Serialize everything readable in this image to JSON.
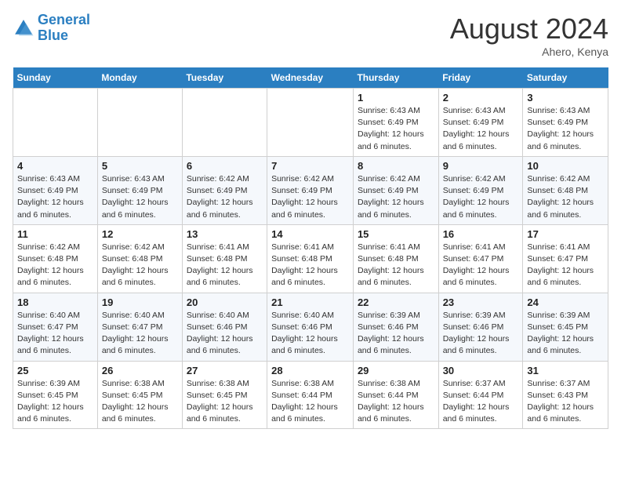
{
  "header": {
    "logo_line1": "General",
    "logo_line2": "Blue",
    "month": "August 2024",
    "location": "Ahero, Kenya"
  },
  "columns": [
    "Sunday",
    "Monday",
    "Tuesday",
    "Wednesday",
    "Thursday",
    "Friday",
    "Saturday"
  ],
  "weeks": [
    [
      {
        "day": "",
        "info": ""
      },
      {
        "day": "",
        "info": ""
      },
      {
        "day": "",
        "info": ""
      },
      {
        "day": "",
        "info": ""
      },
      {
        "day": "1",
        "info": "Sunrise: 6:43 AM\nSunset: 6:49 PM\nDaylight: 12 hours and 6 minutes."
      },
      {
        "day": "2",
        "info": "Sunrise: 6:43 AM\nSunset: 6:49 PM\nDaylight: 12 hours and 6 minutes."
      },
      {
        "day": "3",
        "info": "Sunrise: 6:43 AM\nSunset: 6:49 PM\nDaylight: 12 hours and 6 minutes."
      }
    ],
    [
      {
        "day": "4",
        "info": "Sunrise: 6:43 AM\nSunset: 6:49 PM\nDaylight: 12 hours and 6 minutes."
      },
      {
        "day": "5",
        "info": "Sunrise: 6:43 AM\nSunset: 6:49 PM\nDaylight: 12 hours and 6 minutes."
      },
      {
        "day": "6",
        "info": "Sunrise: 6:42 AM\nSunset: 6:49 PM\nDaylight: 12 hours and 6 minutes."
      },
      {
        "day": "7",
        "info": "Sunrise: 6:42 AM\nSunset: 6:49 PM\nDaylight: 12 hours and 6 minutes."
      },
      {
        "day": "8",
        "info": "Sunrise: 6:42 AM\nSunset: 6:49 PM\nDaylight: 12 hours and 6 minutes."
      },
      {
        "day": "9",
        "info": "Sunrise: 6:42 AM\nSunset: 6:49 PM\nDaylight: 12 hours and 6 minutes."
      },
      {
        "day": "10",
        "info": "Sunrise: 6:42 AM\nSunset: 6:48 PM\nDaylight: 12 hours and 6 minutes."
      }
    ],
    [
      {
        "day": "11",
        "info": "Sunrise: 6:42 AM\nSunset: 6:48 PM\nDaylight: 12 hours and 6 minutes."
      },
      {
        "day": "12",
        "info": "Sunrise: 6:42 AM\nSunset: 6:48 PM\nDaylight: 12 hours and 6 minutes."
      },
      {
        "day": "13",
        "info": "Sunrise: 6:41 AM\nSunset: 6:48 PM\nDaylight: 12 hours and 6 minutes."
      },
      {
        "day": "14",
        "info": "Sunrise: 6:41 AM\nSunset: 6:48 PM\nDaylight: 12 hours and 6 minutes."
      },
      {
        "day": "15",
        "info": "Sunrise: 6:41 AM\nSunset: 6:48 PM\nDaylight: 12 hours and 6 minutes."
      },
      {
        "day": "16",
        "info": "Sunrise: 6:41 AM\nSunset: 6:47 PM\nDaylight: 12 hours and 6 minutes."
      },
      {
        "day": "17",
        "info": "Sunrise: 6:41 AM\nSunset: 6:47 PM\nDaylight: 12 hours and 6 minutes."
      }
    ],
    [
      {
        "day": "18",
        "info": "Sunrise: 6:40 AM\nSunset: 6:47 PM\nDaylight: 12 hours and 6 minutes."
      },
      {
        "day": "19",
        "info": "Sunrise: 6:40 AM\nSunset: 6:47 PM\nDaylight: 12 hours and 6 minutes."
      },
      {
        "day": "20",
        "info": "Sunrise: 6:40 AM\nSunset: 6:46 PM\nDaylight: 12 hours and 6 minutes."
      },
      {
        "day": "21",
        "info": "Sunrise: 6:40 AM\nSunset: 6:46 PM\nDaylight: 12 hours and 6 minutes."
      },
      {
        "day": "22",
        "info": "Sunrise: 6:39 AM\nSunset: 6:46 PM\nDaylight: 12 hours and 6 minutes."
      },
      {
        "day": "23",
        "info": "Sunrise: 6:39 AM\nSunset: 6:46 PM\nDaylight: 12 hours and 6 minutes."
      },
      {
        "day": "24",
        "info": "Sunrise: 6:39 AM\nSunset: 6:45 PM\nDaylight: 12 hours and 6 minutes."
      }
    ],
    [
      {
        "day": "25",
        "info": "Sunrise: 6:39 AM\nSunset: 6:45 PM\nDaylight: 12 hours and 6 minutes."
      },
      {
        "day": "26",
        "info": "Sunrise: 6:38 AM\nSunset: 6:45 PM\nDaylight: 12 hours and 6 minutes."
      },
      {
        "day": "27",
        "info": "Sunrise: 6:38 AM\nSunset: 6:45 PM\nDaylight: 12 hours and 6 minutes."
      },
      {
        "day": "28",
        "info": "Sunrise: 6:38 AM\nSunset: 6:44 PM\nDaylight: 12 hours and 6 minutes."
      },
      {
        "day": "29",
        "info": "Sunrise: 6:38 AM\nSunset: 6:44 PM\nDaylight: 12 hours and 6 minutes."
      },
      {
        "day": "30",
        "info": "Sunrise: 6:37 AM\nSunset: 6:44 PM\nDaylight: 12 hours and 6 minutes."
      },
      {
        "day": "31",
        "info": "Sunrise: 6:37 AM\nSunset: 6:43 PM\nDaylight: 12 hours and 6 minutes."
      }
    ]
  ]
}
